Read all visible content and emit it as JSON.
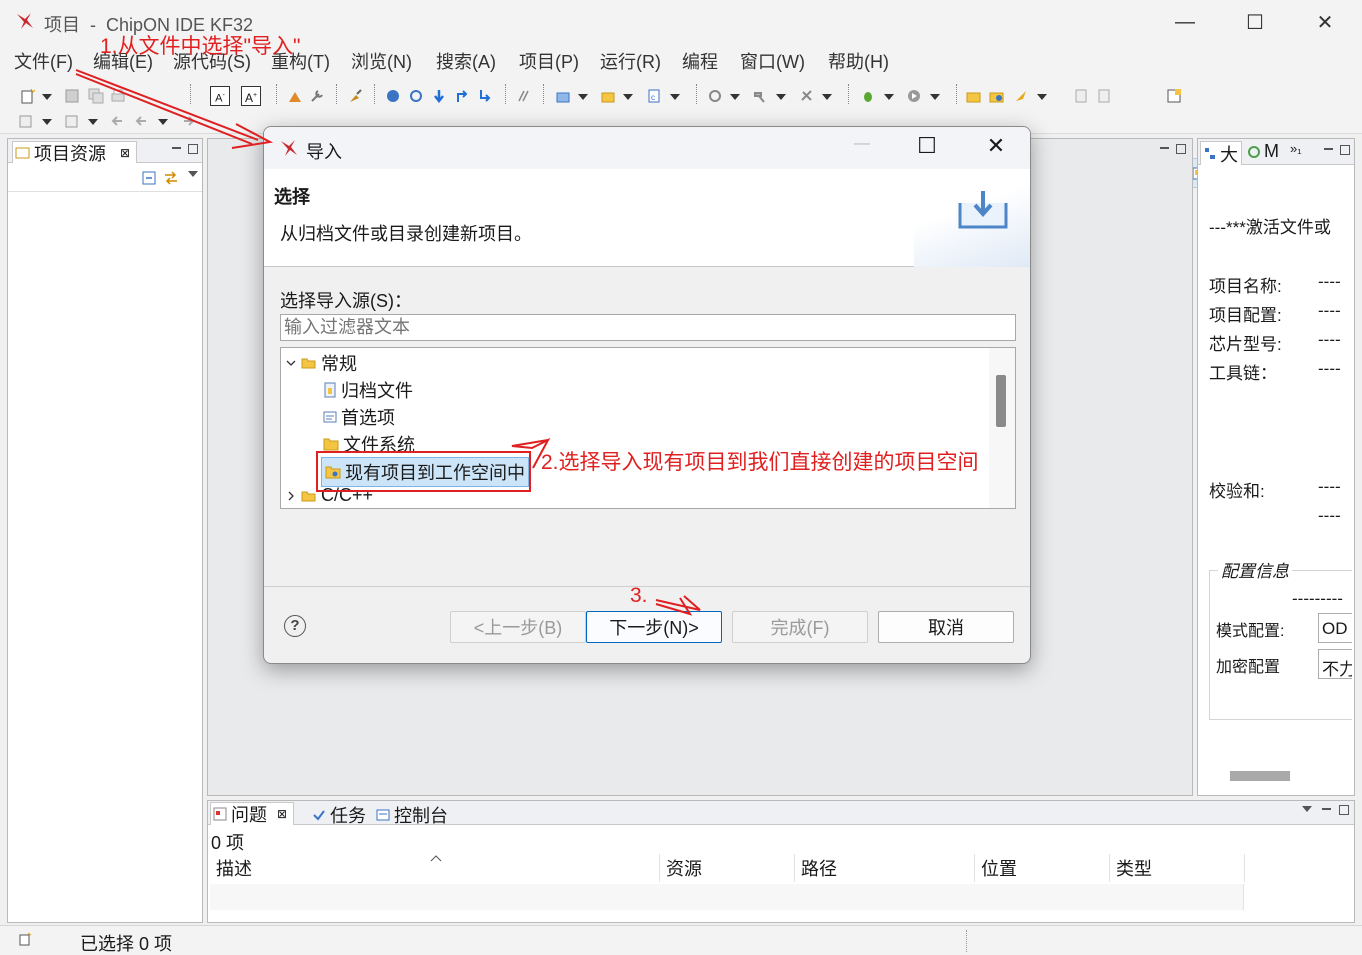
{
  "window": {
    "title": "项目  -  ChipON IDE KF32",
    "minimize": "—",
    "maximize": "☐",
    "close": "✕"
  },
  "menu": [
    "文件(F)",
    "编辑(E)",
    "源代码(S)",
    "重构(T)",
    "浏览(N)",
    "搜索(A)",
    "项目(P)",
    "运行(R)",
    "编程",
    "窗口(W)",
    "帮助(H)"
  ],
  "toolbar": {
    "perspective_label": "项目"
  },
  "left_panel": {
    "tab_label": "项目资源",
    "tab_close": "⊠"
  },
  "right_panel": {
    "tabs": [
      "大",
      "M",
      "»₁"
    ],
    "activate_hint": "---***激活文件或",
    "props": [
      {
        "label": "项目名称:",
        "value": "----"
      },
      {
        "label": "项目配置:",
        "value": "----"
      },
      {
        "label": "芯片型号:",
        "value": "----"
      },
      {
        "label": "工具链：",
        "value": "----"
      }
    ],
    "checksum": {
      "label": "校验和:",
      "value": "----",
      "value2": "----"
    },
    "config_group": {
      "title": "配置信息",
      "dashes": "---------",
      "mode_label": "模式配置:",
      "mode_value": "OD",
      "encrypt_label": "加密配置",
      "encrypt_value": "不力"
    }
  },
  "bottom_panel": {
    "tabs": [
      "问题",
      "任务",
      "控制台"
    ],
    "tab_close": "⊠",
    "count": "0 项",
    "columns": [
      "描述",
      "资源",
      "路径",
      "位置",
      "类型"
    ]
  },
  "status": {
    "selected": "已选择 0 项"
  },
  "dialog": {
    "title": "导入",
    "minimize": "—",
    "maximize": "☐",
    "close": "✕",
    "header_title": "选择",
    "header_desc": "从归档文件或目录创建新项目。",
    "source_label": "选择导入源(S)：",
    "filter_placeholder": "输入过滤器文本",
    "tree": {
      "group_general": "常规",
      "items": [
        "归档文件",
        "首选项",
        "文件系统",
        "现有项目到工作空间中"
      ],
      "group_cpp": "C/C++"
    },
    "help": "?",
    "buttons": {
      "back": "<上一步(B)",
      "next": "下一步(N)>",
      "finish": "完成(F)",
      "cancel": "取消"
    }
  },
  "annotations": {
    "step1": "1.从文件中选择\"导入\"",
    "step2": "2.选择导入现有项目到我们直接创建的项目空间",
    "step3": "3."
  },
  "colors": {
    "annotation": "#e02020",
    "accent": "#0067c0",
    "selection": "#cce4f7"
  }
}
